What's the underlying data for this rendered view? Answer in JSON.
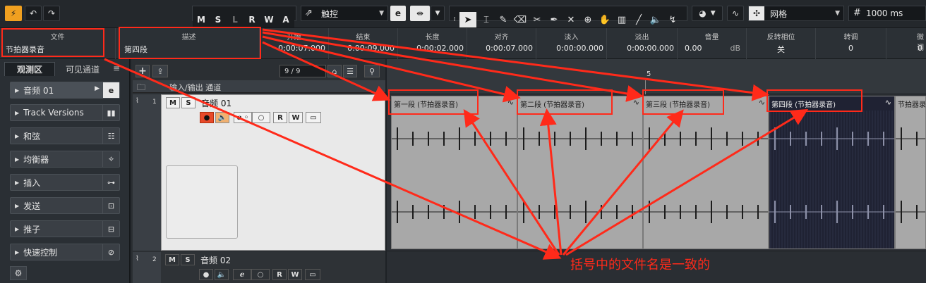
{
  "toolbar": {
    "modes": [
      "M",
      "S",
      "L",
      "R",
      "W",
      "A"
    ],
    "automation_mode": "触控",
    "snap_type": "网格",
    "quantize": "1000 ms"
  },
  "infoline": {
    "columns": [
      {
        "header": "文件",
        "value": "节拍器录音"
      },
      {
        "header": "描述",
        "value": "第四段"
      },
      {
        "header": "开始",
        "value": "0:00:07.000"
      },
      {
        "header": "结束",
        "value": "0:00:09.000"
      },
      {
        "header": "长度",
        "value": "0:00:02.000"
      },
      {
        "header": "对齐",
        "value": "0:00:07.000"
      },
      {
        "header": "淡入",
        "value": "0:00:00.000"
      },
      {
        "header": "淡出",
        "value": "0:00:00.000"
      },
      {
        "header": "音量",
        "value": "0.00",
        "unit": "dB"
      },
      {
        "header": "反转相位",
        "value": "关"
      },
      {
        "header": "转调",
        "value": "0"
      },
      {
        "header": "微调",
        "value": "0"
      }
    ]
  },
  "inspector": {
    "tabs": [
      "观测区",
      "可见通道"
    ],
    "track_name": "音频 01",
    "sections": [
      "Track Versions",
      "和弦",
      "均衡器",
      "插入",
      "发送",
      "推子",
      "快速控制"
    ]
  },
  "tracklist": {
    "counter": "9 / 9",
    "folder_label": "输入/输出 通道",
    "tracks": [
      {
        "number": "1",
        "name": "音频 01"
      },
      {
        "number": "2",
        "name": "音频 02"
      }
    ],
    "btn_m": "M",
    "btn_s": "S",
    "btn_r": "R",
    "btn_w": "W"
  },
  "ruler": {
    "bar_marker": "5"
  },
  "events": [
    {
      "title": "第一段 (节拍器录音)"
    },
    {
      "title": "第二段 (节拍器录音)"
    },
    {
      "title": "第三段 (节拍器录音)"
    },
    {
      "title": "第四段 (节拍器录音)"
    },
    {
      "title": "节拍器录"
    }
  ],
  "annotation": {
    "text": "括号中的文件名是一致的",
    "color": "#ff2a1a"
  },
  "colors": {
    "accent": "#f0a020",
    "annotation": "#ff2a1a",
    "selected_event": "#1f2233",
    "event": "#a8a8a8"
  }
}
